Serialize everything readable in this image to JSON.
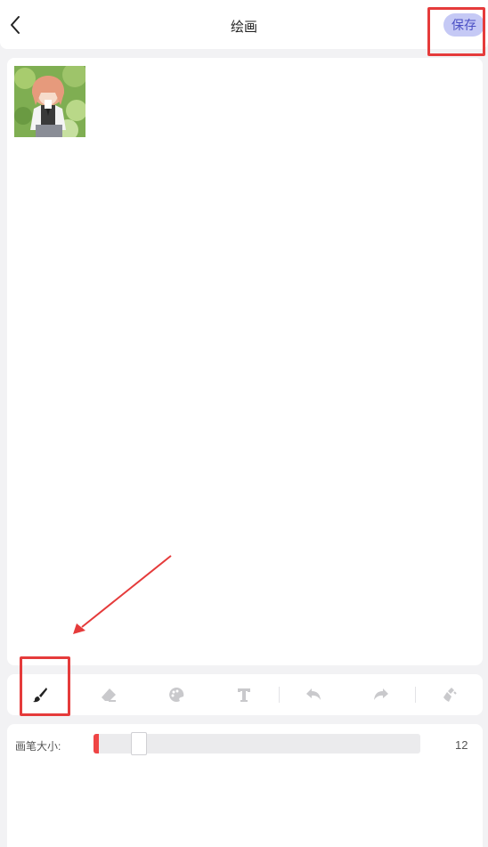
{
  "header": {
    "title": "绘画",
    "save_label": "保存"
  },
  "canvas": {
    "thumbnail": "anime-girl-sticker"
  },
  "toolbar": {
    "tools": [
      {
        "name": "brush-icon",
        "active": true
      },
      {
        "name": "eraser-icon",
        "active": false
      },
      {
        "name": "palette-icon",
        "active": false
      },
      {
        "name": "text-icon",
        "active": false
      },
      {
        "name": "undo-icon",
        "active": false
      },
      {
        "name": "redo-icon",
        "active": false
      },
      {
        "name": "clear-icon",
        "active": false
      }
    ]
  },
  "brush": {
    "size_label": "画笔大小:",
    "size_value": "12",
    "size_fraction": 0.12
  },
  "colors": {
    "accent": "#c5c9f5",
    "accent_text": "#4a4fc4",
    "slider_fill": "#ef4545",
    "annotation": "#e53b3b",
    "icon_inactive": "#c9c9cc",
    "icon_active": "#222222"
  }
}
